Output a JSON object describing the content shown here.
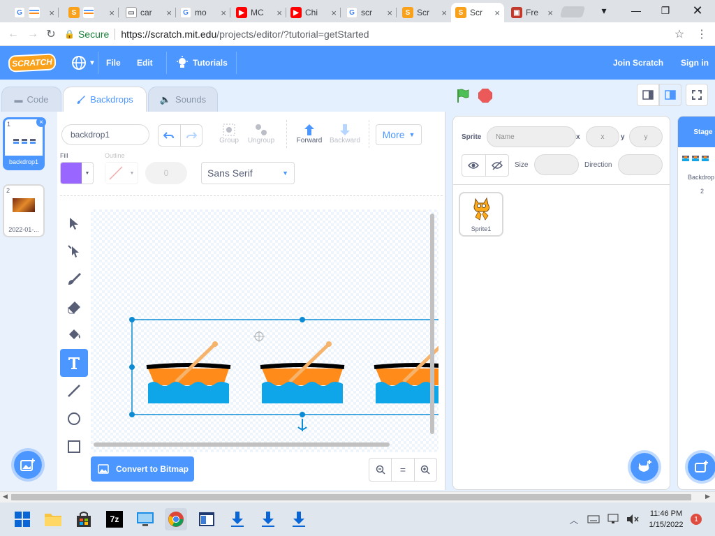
{
  "browser": {
    "tabs": [
      {
        "title": "car",
        "icon": "google-icon"
      },
      {
        "title": "mo",
        "icon": "google-icon"
      },
      {
        "title": "MC",
        "icon": "youtube-icon"
      },
      {
        "title": "Chi",
        "icon": "youtube-icon"
      },
      {
        "title": "scr",
        "icon": "google-icon"
      },
      {
        "title": "Scr",
        "icon": "scratch-icon"
      },
      {
        "title": "Scr",
        "icon": "scratch-icon"
      },
      {
        "title": "Fre",
        "icon": "website-icon"
      }
    ],
    "secure_label": "Secure",
    "url_host": "https://scratch.mit.edu",
    "url_path": "/projects/editor/?tutorial=getStarted"
  },
  "menubar": {
    "logo": "SCRATCH",
    "file": "File",
    "edit": "Edit",
    "tutorials": "Tutorials",
    "join": "Join Scratch",
    "signin": "Sign in"
  },
  "editor_tabs": {
    "code": "Code",
    "backdrops": "Backdrops",
    "sounds": "Sounds"
  },
  "costumes": [
    {
      "num": "1",
      "label": "backdrop1"
    },
    {
      "num": "2",
      "label": "2022-01-..."
    }
  ],
  "paint": {
    "costume_name": "backdrop1",
    "group": "Group",
    "ungroup": "Ungroup",
    "forward": "Forward",
    "backward": "Backward",
    "more": "More",
    "fill_label": "Fill",
    "outline_label": "Outline",
    "outline_width": "0",
    "font": "Sans Serif",
    "convert": "Convert to Bitmap",
    "zoom_reset": "="
  },
  "sprite_info": {
    "sprite_label": "Sprite",
    "name_placeholder": "Name",
    "x_label": "x",
    "x_placeholder": "x",
    "y_label": "y",
    "y_placeholder": "y",
    "size_label": "Size",
    "direction_label": "Direction"
  },
  "sprites": [
    {
      "name": "Sprite1"
    }
  ],
  "stage": {
    "title": "Stage",
    "backdrops_label": "Backdrop",
    "backdrop_count": "2"
  },
  "taskbar": {
    "time": "11:46 PM",
    "date": "1/15/2022",
    "notifications": "1"
  },
  "colors": {
    "scratch_blue": "#4c97ff",
    "fill": "#9966ff",
    "boat_orange": "#ff8c1a",
    "water_blue": "#0fa5e9"
  }
}
